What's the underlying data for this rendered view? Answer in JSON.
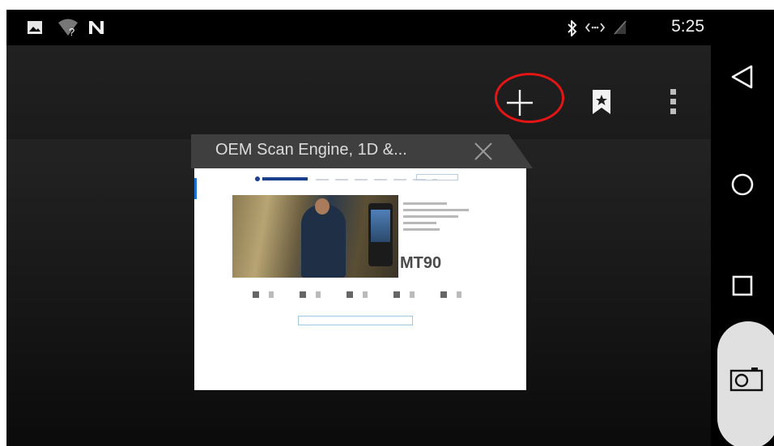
{
  "status_bar": {
    "time": "5:25",
    "icons": [
      "image-icon",
      "wifi-question-icon",
      "nfc-n-icon",
      "bluetooth-icon",
      "data-transfer-icon",
      "battery-empty-icon"
    ]
  },
  "toolbar": {
    "icons": [
      "plus-icon",
      "bookmark-star-icon",
      "overflow-menu-icon"
    ]
  },
  "tab": {
    "title": "OEM Scan Engine, 1D &...",
    "thumbnail": {
      "model": "MT90"
    }
  },
  "nav_bar": {
    "icons": [
      "back-triangle-icon",
      "home-circle-icon",
      "recents-square-icon",
      "camera-icon"
    ]
  },
  "colors": {
    "highlight": "#e31515",
    "tab_header": "#3f3f3f",
    "toolbar": "#212121"
  }
}
